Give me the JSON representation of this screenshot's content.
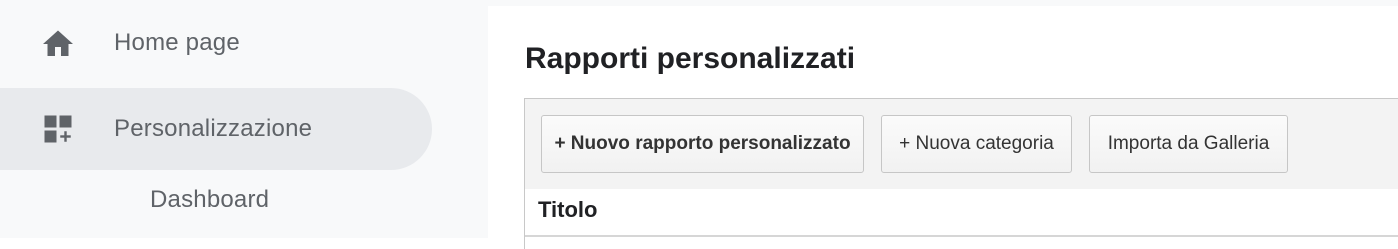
{
  "sidebar": {
    "items": [
      {
        "label": "Home page",
        "icon": "home-icon"
      },
      {
        "label": "Personalizzazione",
        "icon": "dashboard-add-icon",
        "selected": true
      }
    ],
    "subitems": [
      {
        "label": "Dashboard"
      }
    ]
  },
  "main": {
    "title": "Rapporti personalizzati",
    "toolbar": {
      "new_report_label": "+ Nuovo rapporto personalizzato",
      "new_category_label": "+ Nuova categoria",
      "import_label": "Importa da Galleria"
    },
    "table": {
      "columns": [
        "Titolo"
      ]
    }
  },
  "colors": {
    "sidebar_bg": "#f8f9fa",
    "selected_bg": "#e8eaed",
    "icon": "#5f6368",
    "toolbar_bg": "#f3f3f3",
    "title_text": "#202124"
  }
}
